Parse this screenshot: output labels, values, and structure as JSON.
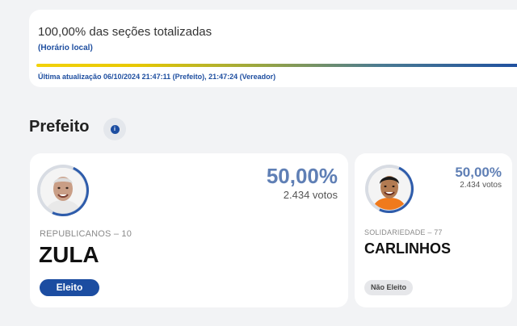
{
  "status": {
    "title": "100,00% das seções totalizadas",
    "local_time_note": "(Horário local)",
    "progress_percent": 100,
    "last_update": "Última atualização 06/10/2024 21:47:11 (Prefeito), 21:47:24 (Vereador)"
  },
  "section": {
    "title": "Prefeito",
    "info_icon": "info-icon"
  },
  "candidates": [
    {
      "percent": "50,00%",
      "votes": "2.434 votos",
      "party": "REPUBLICANOS – 10",
      "name": "ZULA",
      "result": "Eleito"
    },
    {
      "percent": "50,00%",
      "votes": "2.434 votos",
      "party": "SOLIDARIEDADE – 77",
      "name": "CARLINHOS",
      "result": "Não Eleito"
    }
  ],
  "colors": {
    "accent": "#1c4da1",
    "percent_text": "#5f7fb5",
    "progress_start": "#f2d20b",
    "background": "#f2f3f5"
  }
}
